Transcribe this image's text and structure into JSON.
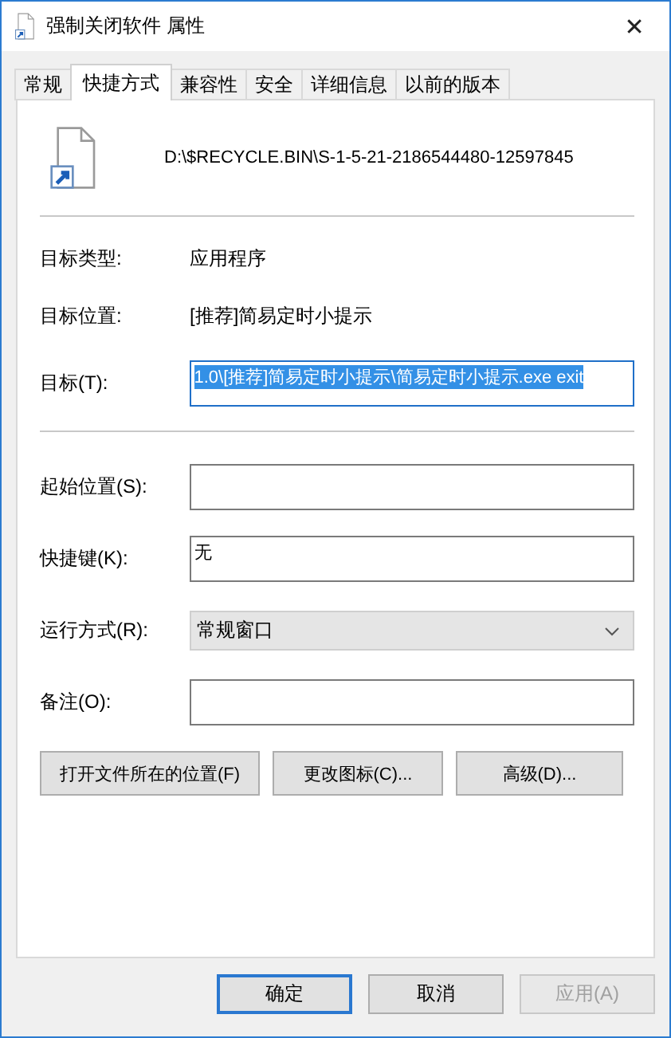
{
  "window": {
    "title": "强制关闭软件 属性",
    "close": "✕"
  },
  "tabs": [
    {
      "label": "常规",
      "selected": false
    },
    {
      "label": "快捷方式",
      "selected": true
    },
    {
      "label": "兼容性",
      "selected": false
    },
    {
      "label": "安全",
      "selected": false
    },
    {
      "label": "详细信息",
      "selected": false
    },
    {
      "label": "以前的版本",
      "selected": false
    }
  ],
  "shortcut": {
    "path": "D:\\$RECYCLE.BIN\\S-1-5-21-2186544480-12597845"
  },
  "info": [
    {
      "label": "目标类型:",
      "value": "应用程序"
    },
    {
      "label": "目标位置:",
      "value": "[推荐]简易定时小提示"
    }
  ],
  "target": {
    "label": "目标(T):",
    "value": "1.0\\[推荐]简易定时小提示\\简易定时小提示.exe exit",
    "highlighted": true
  },
  "fields": [
    {
      "kind": "input",
      "label": "起始位置(S):"
    },
    {
      "kind": "input",
      "label": "快捷键(K):",
      "value": "无"
    },
    {
      "kind": "select",
      "label": "运行方式(R):",
      "value": "常规窗口"
    },
    {
      "kind": "input",
      "label": "备注(O):"
    }
  ],
  "buttons": [
    "打开文件所在的位置(F)",
    "更改图标(C)...",
    "高级(D)..."
  ],
  "dialog_buttons": [
    {
      "label": "确定",
      "default": true,
      "disabled": false
    },
    {
      "label": "取消",
      "default": false,
      "disabled": false
    },
    {
      "label": "应用(A)",
      "default": false,
      "disabled": true
    }
  ]
}
